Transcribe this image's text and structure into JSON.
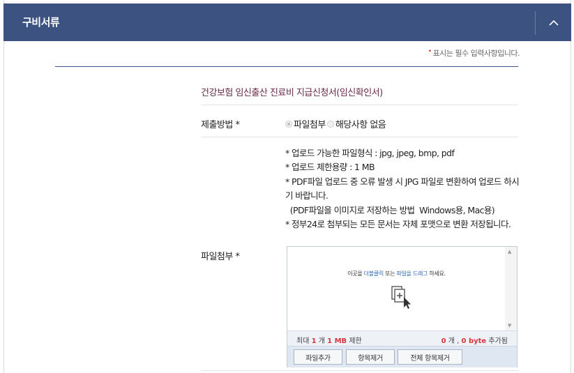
{
  "header": {
    "title": "구비서류",
    "toggle_icon": "chevron-up-icon"
  },
  "required_note": {
    "marker": "•",
    "text": "표시는 필수 입력사항입니다."
  },
  "document": {
    "title": "건강보험 임신출산 진료비 지급신청서(임신확인서)"
  },
  "submission": {
    "label": "제출방법 *",
    "options": [
      {
        "label": "파일첨부",
        "checked": true
      },
      {
        "label": "해당사항 없음",
        "checked": false
      }
    ]
  },
  "attachment": {
    "label": "파일첨부 *",
    "info": [
      "* 업로드 가능한 파일형식 : jpg, jpeg, bmp, pdf",
      "* 업로드 제한용량 : 1 MB",
      "* PDF파일 업로드 중 오류 발생 시 JPG 파일로 변환하여 업로드 하시기 바랍니다.",
      "  (PDF파일을 이미지로 저장하는 방법  Windows용, Mac용)",
      "* 정부24로 첨부되는 모든 문서는 자체 포맷으로 변환 저장됩니다."
    ],
    "uploader": {
      "drop_prefix": "이곳을 ",
      "drop_dblclick": "더블클릭",
      "drop_middle": " 또는 ",
      "drop_drag": "파일을 드래그",
      "drop_suffix": " 하세요.",
      "limit_prefix": "최대 ",
      "limit_count": "1",
      "limit_mid": " 개 ",
      "limit_size": "1 MB",
      "limit_suffix": " 제한",
      "added_count": "0",
      "added_mid": " 개 , ",
      "added_size": "0 byte",
      "added_suffix": " 추가됨",
      "buttons": {
        "add": "파일추가",
        "remove": "항목제거",
        "remove_all": "전체 항목제거"
      }
    }
  },
  "colors": {
    "header_bg": "#3c5280",
    "doc_title": "#6b2a49",
    "accent_red": "#d9363e"
  }
}
